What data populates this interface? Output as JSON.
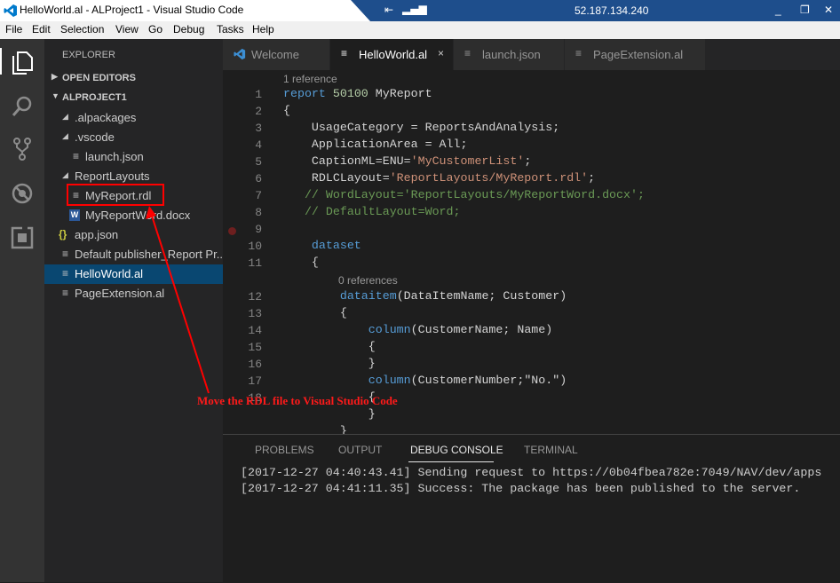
{
  "window": {
    "title": "HelloWorld.al - ALProject1 - Visual Studio Code",
    "remote_ip": "52.187.134.240",
    "controls": [
      "_",
      "❐",
      "✕"
    ]
  },
  "menu": [
    "File",
    "Edit",
    "Selection",
    "View",
    "Go",
    "Debug",
    "Tasks",
    "Help"
  ],
  "activity": [
    "files-icon",
    "search-icon",
    "source-control-icon",
    "debug-icon",
    "extensions-icon"
  ],
  "sidebar": {
    "header": "EXPLORER",
    "open_editors": "OPEN EDITORS",
    "project": "ALPROJECT1",
    "items": [
      {
        "label": ".alpackages",
        "type": "folder"
      },
      {
        "label": ".vscode",
        "type": "folder"
      },
      {
        "label": "launch.json",
        "type": "file"
      },
      {
        "label": "ReportLayouts",
        "type": "folder"
      },
      {
        "label": "MyReport.rdl",
        "type": "file"
      },
      {
        "label": "MyReportWord.docx",
        "type": "word"
      },
      {
        "label": "app.json",
        "type": "json"
      },
      {
        "label": "Default publisher_Report Pr...",
        "type": "file"
      },
      {
        "label": "HelloWorld.al",
        "type": "file"
      },
      {
        "label": "PageExtension.al",
        "type": "file"
      }
    ]
  },
  "tabs": [
    {
      "label": "Welcome",
      "icon": "vscode-icon"
    },
    {
      "label": "HelloWorld.al",
      "icon": "file-icon",
      "active": true,
      "close": "×"
    },
    {
      "label": "launch.json",
      "icon": "file-icon"
    },
    {
      "label": "PageExtension.al",
      "icon": "file-icon"
    }
  ],
  "editor": {
    "codelens": [
      "1 reference",
      "0 references"
    ],
    "line_numbers": [
      "1",
      "2",
      "3",
      "4",
      "5",
      "6",
      "7",
      "8",
      "9",
      "10",
      "11",
      "12",
      "13",
      "14",
      "15",
      "16",
      "17",
      "18"
    ]
  },
  "panel": {
    "tabs": [
      "PROBLEMS",
      "OUTPUT",
      "DEBUG CONSOLE",
      "TERMINAL"
    ],
    "active_tab": "DEBUG CONSOLE",
    "lines": [
      "[2017-12-27 04:40:43.41] Sending request to https://0b04fbea782e:7049/NAV/dev/apps",
      "[2017-12-27 04:41:11.35] Success: The package has been published to the server."
    ]
  },
  "annotation": {
    "text": "Move the RDL file to Visual Studio Code",
    "color": "#ff0000"
  },
  "colors": {
    "accent": "#007acc",
    "selection": "#094771",
    "keyword": "#569cd6",
    "string": "#ce9178",
    "comment": "#6a9955"
  }
}
